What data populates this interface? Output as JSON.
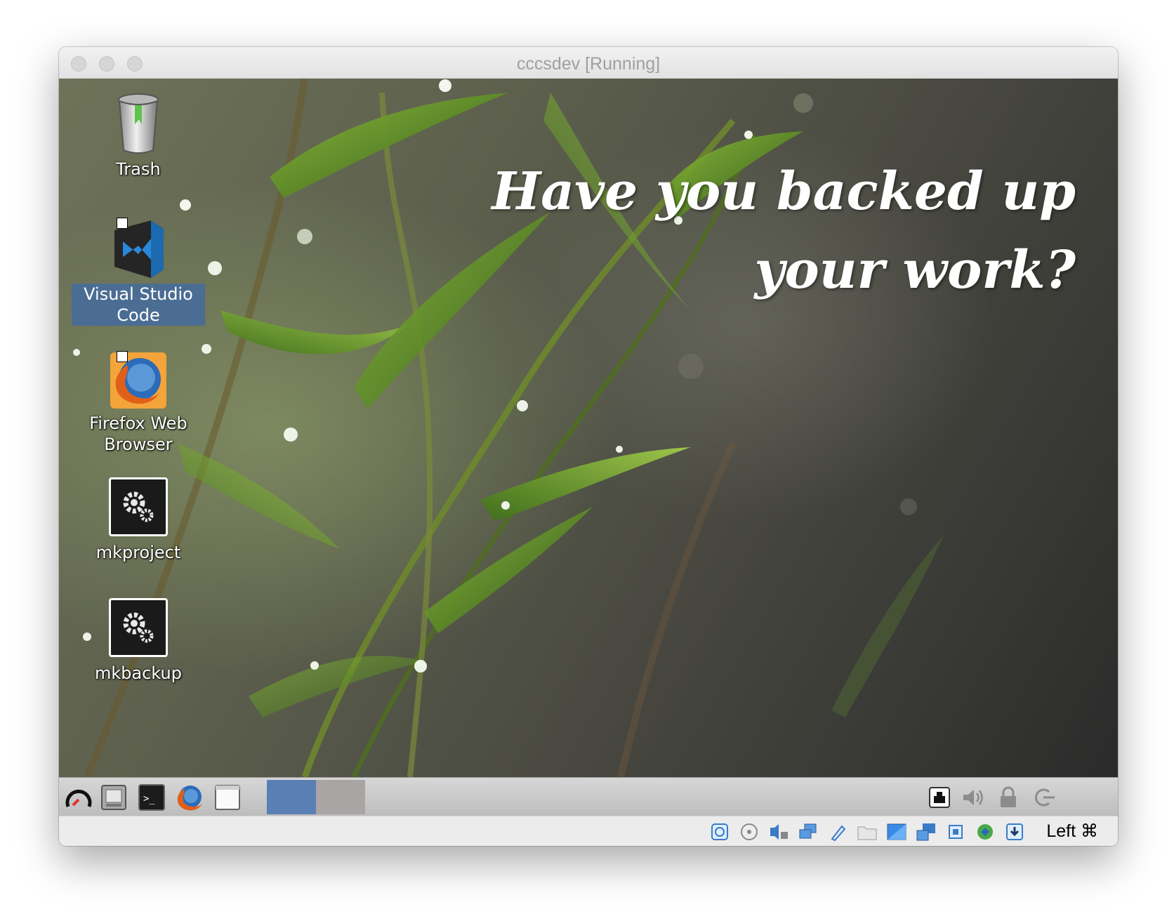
{
  "window": {
    "title": "cccsdev [Running]"
  },
  "wallpaper": {
    "text_line1": "Have you backed up",
    "text_line2": "your work?"
  },
  "desktop_icons": [
    {
      "label": "Trash",
      "icon": "trash-icon",
      "selected": false
    },
    {
      "label": "Visual Studio Code",
      "icon": "vscode-icon",
      "selected": true
    },
    {
      "label": "Firefox Web Browser",
      "icon": "firefox-icon",
      "selected": false
    },
    {
      "label": "mkproject",
      "icon": "gears-icon",
      "selected": false
    },
    {
      "label": "mkbackup",
      "icon": "gears-icon",
      "selected": false
    }
  ],
  "taskbar": {
    "launchers": [
      "menu-icon",
      "file-manager-icon",
      "terminal-icon",
      "firefox-icon",
      "blank-window-icon"
    ],
    "workspaces": 2,
    "tray": [
      "network-icon",
      "volume-icon",
      "lock-icon",
      "logout-icon"
    ]
  },
  "statusbar": {
    "icons": [
      "hard-disk-icon",
      "optical-drive-icon",
      "audio-icon",
      "network-icon",
      "usb-icon",
      "shared-folders-icon",
      "display-icon",
      "video-capture-icon",
      "cpu-icon",
      "guest-additions-icon",
      "download-icon"
    ],
    "host_key": "Left ⌘"
  },
  "colors": {
    "selection": "#4b6d93",
    "workspace_active": "#5a7fb5",
    "workspace_inactive": "#a9a5a5"
  }
}
